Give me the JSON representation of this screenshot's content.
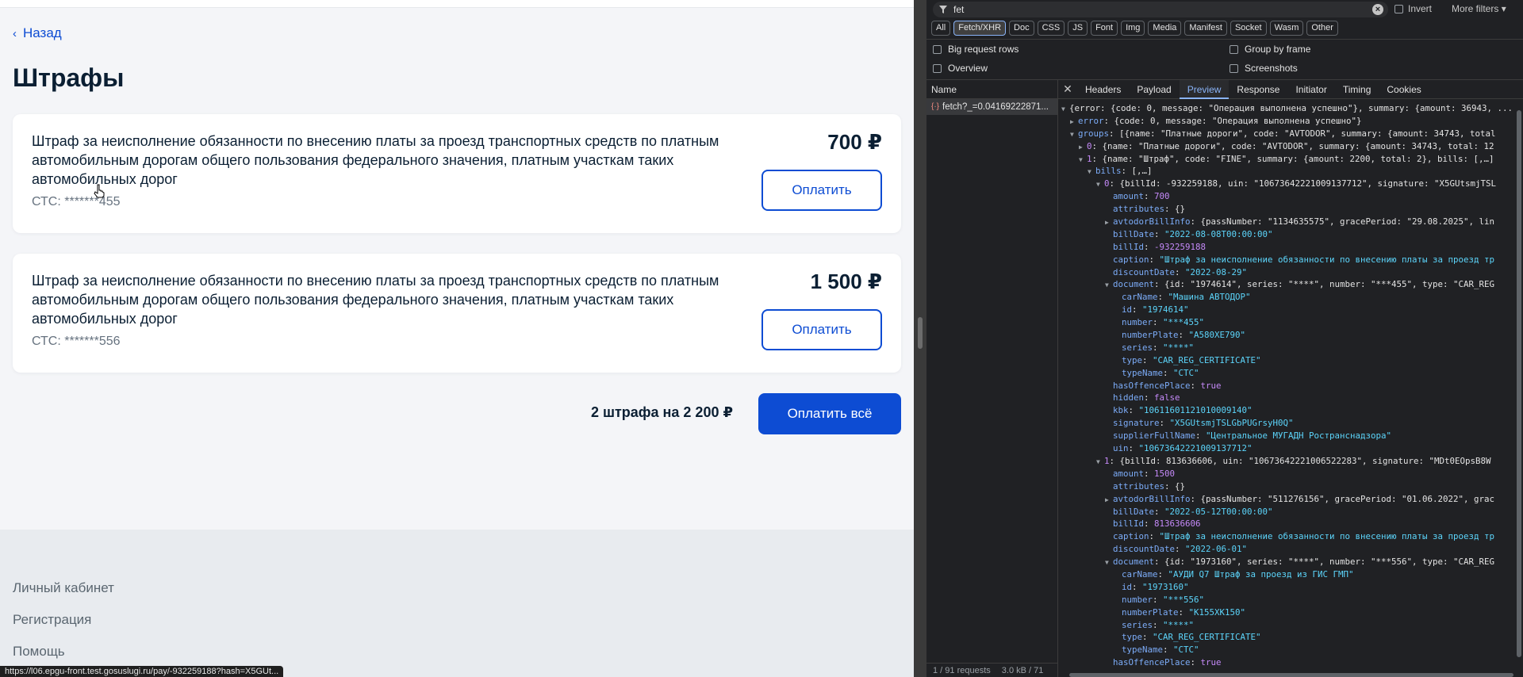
{
  "page": {
    "back_label": "Назад",
    "title": "Штрафы",
    "fines": [
      {
        "description": "Штраф за неисполнение обязанности по внесению платы за проезд транспортных средств по платным автомобильным дорогам общего пользования федерального значения, платным участкам таких автомобильных дорог",
        "document": "СТС: *******455",
        "amount": "700 ₽",
        "pay_label": "Оплатить"
      },
      {
        "description": "Штраф за неисполнение обязанности по внесению платы за проезд транспортных средств по платным автомобильным дорогам общего пользования федерального значения, платным участкам таких автомобильных дорог",
        "document": "СТС: *******556",
        "amount": "1 500 ₽",
        "pay_label": "Оплатить"
      }
    ],
    "total_label": "2 штрафа на 2 200 ₽",
    "pay_all_label": "Оплатить всё",
    "footer_links": [
      "Личный кабинет",
      "Регистрация",
      "Помощь"
    ],
    "status_url": "https://l06.epgu-front.test.gosuslugi.ru/pay/-932259188?hash=X5GUt..."
  },
  "devtools": {
    "filter_text": "fet",
    "invert_label": "Invert",
    "more_filters_label": "More filters",
    "type_chips": [
      "All",
      "Fetch/XHR",
      "Doc",
      "CSS",
      "JS",
      "Font",
      "Img",
      "Media",
      "Manifest",
      "Socket",
      "Wasm",
      "Other"
    ],
    "active_chip": "Fetch/XHR",
    "options": {
      "big_rows": "Big request rows",
      "group_by_frame": "Group by frame",
      "overview": "Overview",
      "screenshots": "Screenshots"
    },
    "name_header": "Name",
    "request_name": "fetch?_=0.04169222871...",
    "footer_requests": "1 / 91 requests",
    "footer_size": "3.0 kB / 71",
    "tabs": [
      "Headers",
      "Payload",
      "Preview",
      "Response",
      "Initiator",
      "Timing",
      "Cookies"
    ],
    "active_tab": "Preview",
    "preview_lines": [
      {
        "i": 0,
        "t": "open",
        "p": "{error: {code: 0, message: \"Операция выполнена успешно\"}, summary: {amount: 36943, ..."
      },
      {
        "i": 1,
        "t": "closed",
        "k": "error",
        "p": "{code: 0, message: \"Операция выполнена успешно\"}"
      },
      {
        "i": 1,
        "t": "open",
        "k": "groups",
        "p": "[{name: \"Платные дороги\", code: \"AVTODOR\", summary: {amount: 34743, total"
      },
      {
        "i": 2,
        "t": "closed",
        "k": "0",
        "idx": true,
        "p": "{name: \"Платные дороги\", code: \"AVTODOR\", summary: {amount: 34743, total: 12"
      },
      {
        "i": 2,
        "t": "open",
        "k": "1",
        "idx": true,
        "p": "{name: \"Штраф\", code: \"FINE\", summary: {amount: 2200, total: 2}, bills: [,…]"
      },
      {
        "i": 3,
        "t": "open",
        "k": "bills",
        "p": "[,…]"
      },
      {
        "i": 4,
        "t": "open",
        "k": "0",
        "idx": true,
        "p": "{billId: -932259188, uin: \"10673642221009137712\", signature: \"X5GUtsmjTSL"
      },
      {
        "i": 5,
        "k": "amount",
        "n": "700"
      },
      {
        "i": 5,
        "k": "attributes",
        "p": "{}"
      },
      {
        "i": 5,
        "t": "closed",
        "k": "avtodorBillInfo",
        "p": "{passNumber: \"1134635575\", gracePeriod: \"29.08.2025\", lin"
      },
      {
        "i": 5,
        "k": "billDate",
        "s": "\"2022-08-08T00:00:00\""
      },
      {
        "i": 5,
        "k": "billId",
        "n": "-932259188"
      },
      {
        "i": 5,
        "k": "caption",
        "s": "\"Штраф за неисполнение обязанности по внесению платы за проезд тр"
      },
      {
        "i": 5,
        "k": "discountDate",
        "s": "\"2022-08-29\""
      },
      {
        "i": 5,
        "t": "open",
        "k": "document",
        "p": "{id: \"1974614\", series: \"****\", number: \"***455\", type: \"CAR_REG"
      },
      {
        "i": 6,
        "k": "carName",
        "s": "\"Машина АВТОДОР\""
      },
      {
        "i": 6,
        "k": "id",
        "s": "\"1974614\""
      },
      {
        "i": 6,
        "k": "number",
        "s": "\"***455\""
      },
      {
        "i": 6,
        "k": "numberPlate",
        "s": "\"А580ХЕ790\""
      },
      {
        "i": 6,
        "k": "series",
        "s": "\"****\""
      },
      {
        "i": 6,
        "k": "type",
        "s": "\"CAR_REG_CERTIFICATE\""
      },
      {
        "i": 6,
        "k": "typeName",
        "s": "\"СТС\""
      },
      {
        "i": 5,
        "k": "hasOffencePlace",
        "n": "true"
      },
      {
        "i": 5,
        "k": "hidden",
        "n": "false"
      },
      {
        "i": 5,
        "k": "kbk",
        "s": "\"10611601121010009140\""
      },
      {
        "i": 5,
        "k": "signature",
        "s": "\"X5GUtsmjTSLGbPUGrsyH0Q\""
      },
      {
        "i": 5,
        "k": "supplierFullName",
        "s": "\"Центральное МУГАДН Ространснадзора\""
      },
      {
        "i": 5,
        "k": "uin",
        "s": "\"10673642221009137712\""
      },
      {
        "i": 4,
        "t": "open",
        "k": "1",
        "idx": true,
        "p": "{billId: 813636606, uin: \"10673642221006522283\", signature: \"MDt0EOpsB8W"
      },
      {
        "i": 5,
        "k": "amount",
        "n": "1500"
      },
      {
        "i": 5,
        "k": "attributes",
        "p": "{}"
      },
      {
        "i": 5,
        "t": "closed",
        "k": "avtodorBillInfo",
        "p": "{passNumber: \"511276156\", gracePeriod: \"01.06.2022\", grac"
      },
      {
        "i": 5,
        "k": "billDate",
        "s": "\"2022-05-12T00:00:00\""
      },
      {
        "i": 5,
        "k": "billId",
        "n": "813636606"
      },
      {
        "i": 5,
        "k": "caption",
        "s": "\"Штраф за неисполнение обязанности по внесению платы за проезд тр"
      },
      {
        "i": 5,
        "k": "discountDate",
        "s": "\"2022-06-01\""
      },
      {
        "i": 5,
        "t": "open",
        "k": "document",
        "p": "{id: \"1973160\", series: \"****\", number: \"***556\", type: \"CAR_REG"
      },
      {
        "i": 6,
        "k": "carName",
        "s": "\"АУДИ Q7 Штраф за проезд из ГИС ГМП\""
      },
      {
        "i": 6,
        "k": "id",
        "s": "\"1973160\""
      },
      {
        "i": 6,
        "k": "number",
        "s": "\"***556\""
      },
      {
        "i": 6,
        "k": "numberPlate",
        "s": "\"К155ХК150\""
      },
      {
        "i": 6,
        "k": "series",
        "s": "\"****\""
      },
      {
        "i": 6,
        "k": "type",
        "s": "\"CAR_REG_CERTIFICATE\""
      },
      {
        "i": 6,
        "k": "typeName",
        "s": "\"СТС\""
      },
      {
        "i": 5,
        "k": "hasOffencePlace",
        "n": "true"
      }
    ]
  }
}
